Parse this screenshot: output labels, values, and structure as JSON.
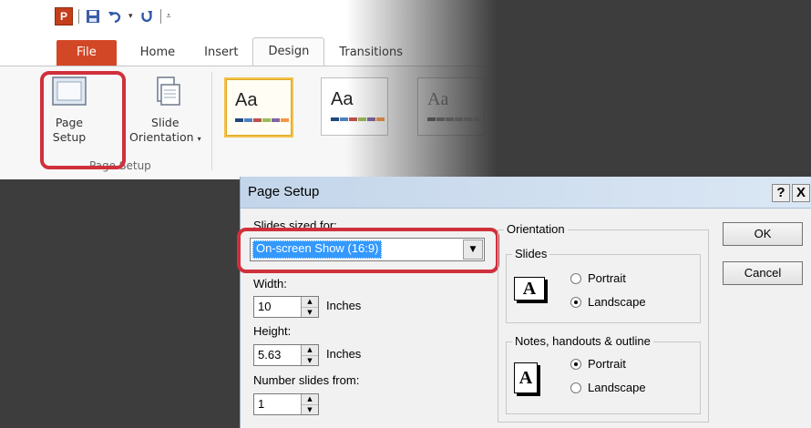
{
  "ribbon": {
    "app_logo_letter": "P",
    "tabs": [
      "File",
      "Home",
      "Insert",
      "Design",
      "Transitions"
    ],
    "active_tab": "Design",
    "page_setup_line1": "Page",
    "page_setup_line2": "Setup",
    "slide_orientation_line1": "Slide",
    "slide_orientation_line2": "Orientation",
    "group_label": "Page Setup",
    "theme_sample": "Aa",
    "colors": {
      "file_tab": "#d24726",
      "highlight": "#d0303b"
    }
  },
  "dialog": {
    "title": "Page Setup",
    "help_button": "?",
    "close_button": "X",
    "slides_sized_for_label": "Slides sized for:",
    "slides_sized_for_value": "On-screen Show (16:9)",
    "width_label": "Width:",
    "width_value": "10",
    "width_unit": "Inches",
    "height_label": "Height:",
    "height_value": "5.63",
    "height_unit": "Inches",
    "number_from_label": "Number slides from:",
    "number_from_value": "1",
    "orientation_label": "Orientation",
    "slides_group_label": "Slides",
    "slides_portrait": "Portrait",
    "slides_landscape": "Landscape",
    "slides_selected": "Landscape",
    "notes_group_label": "Notes, handouts & outline",
    "notes_portrait": "Portrait",
    "notes_landscape": "Landscape",
    "notes_selected": "Portrait",
    "icon_letter": "A",
    "ok_button": "OK",
    "cancel_button": "Cancel"
  }
}
